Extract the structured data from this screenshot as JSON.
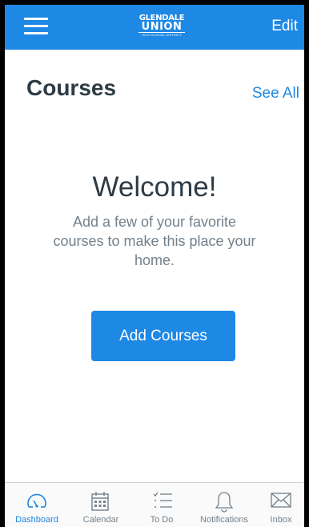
{
  "header": {
    "logo_line1": "GLENDALE",
    "logo_line2": "UNION",
    "logo_line3": "HIGH SCHOOL DISTRICT",
    "edit_label": "Edit",
    "bg_color": "#1e88e5"
  },
  "courses": {
    "title": "Courses",
    "see_all": "See All"
  },
  "empty_state": {
    "heading": "Welcome!",
    "message": "Add a few of your favorite courses to make this place your home.",
    "button": "Add Courses"
  },
  "tabbar": {
    "active": "Dashboard",
    "tabs": [
      {
        "label": "Dashboard",
        "icon": "dashboard-icon"
      },
      {
        "label": "Calendar",
        "icon": "calendar-icon"
      },
      {
        "label": "To Do",
        "icon": "todo-icon"
      },
      {
        "label": "Notifications",
        "icon": "bell-icon"
      },
      {
        "label": "Inbox",
        "icon": "envelope-icon"
      }
    ]
  },
  "colors": {
    "accent": "#1e88e5",
    "text_dark": "#2d3b45",
    "text_muted": "#73818c"
  }
}
